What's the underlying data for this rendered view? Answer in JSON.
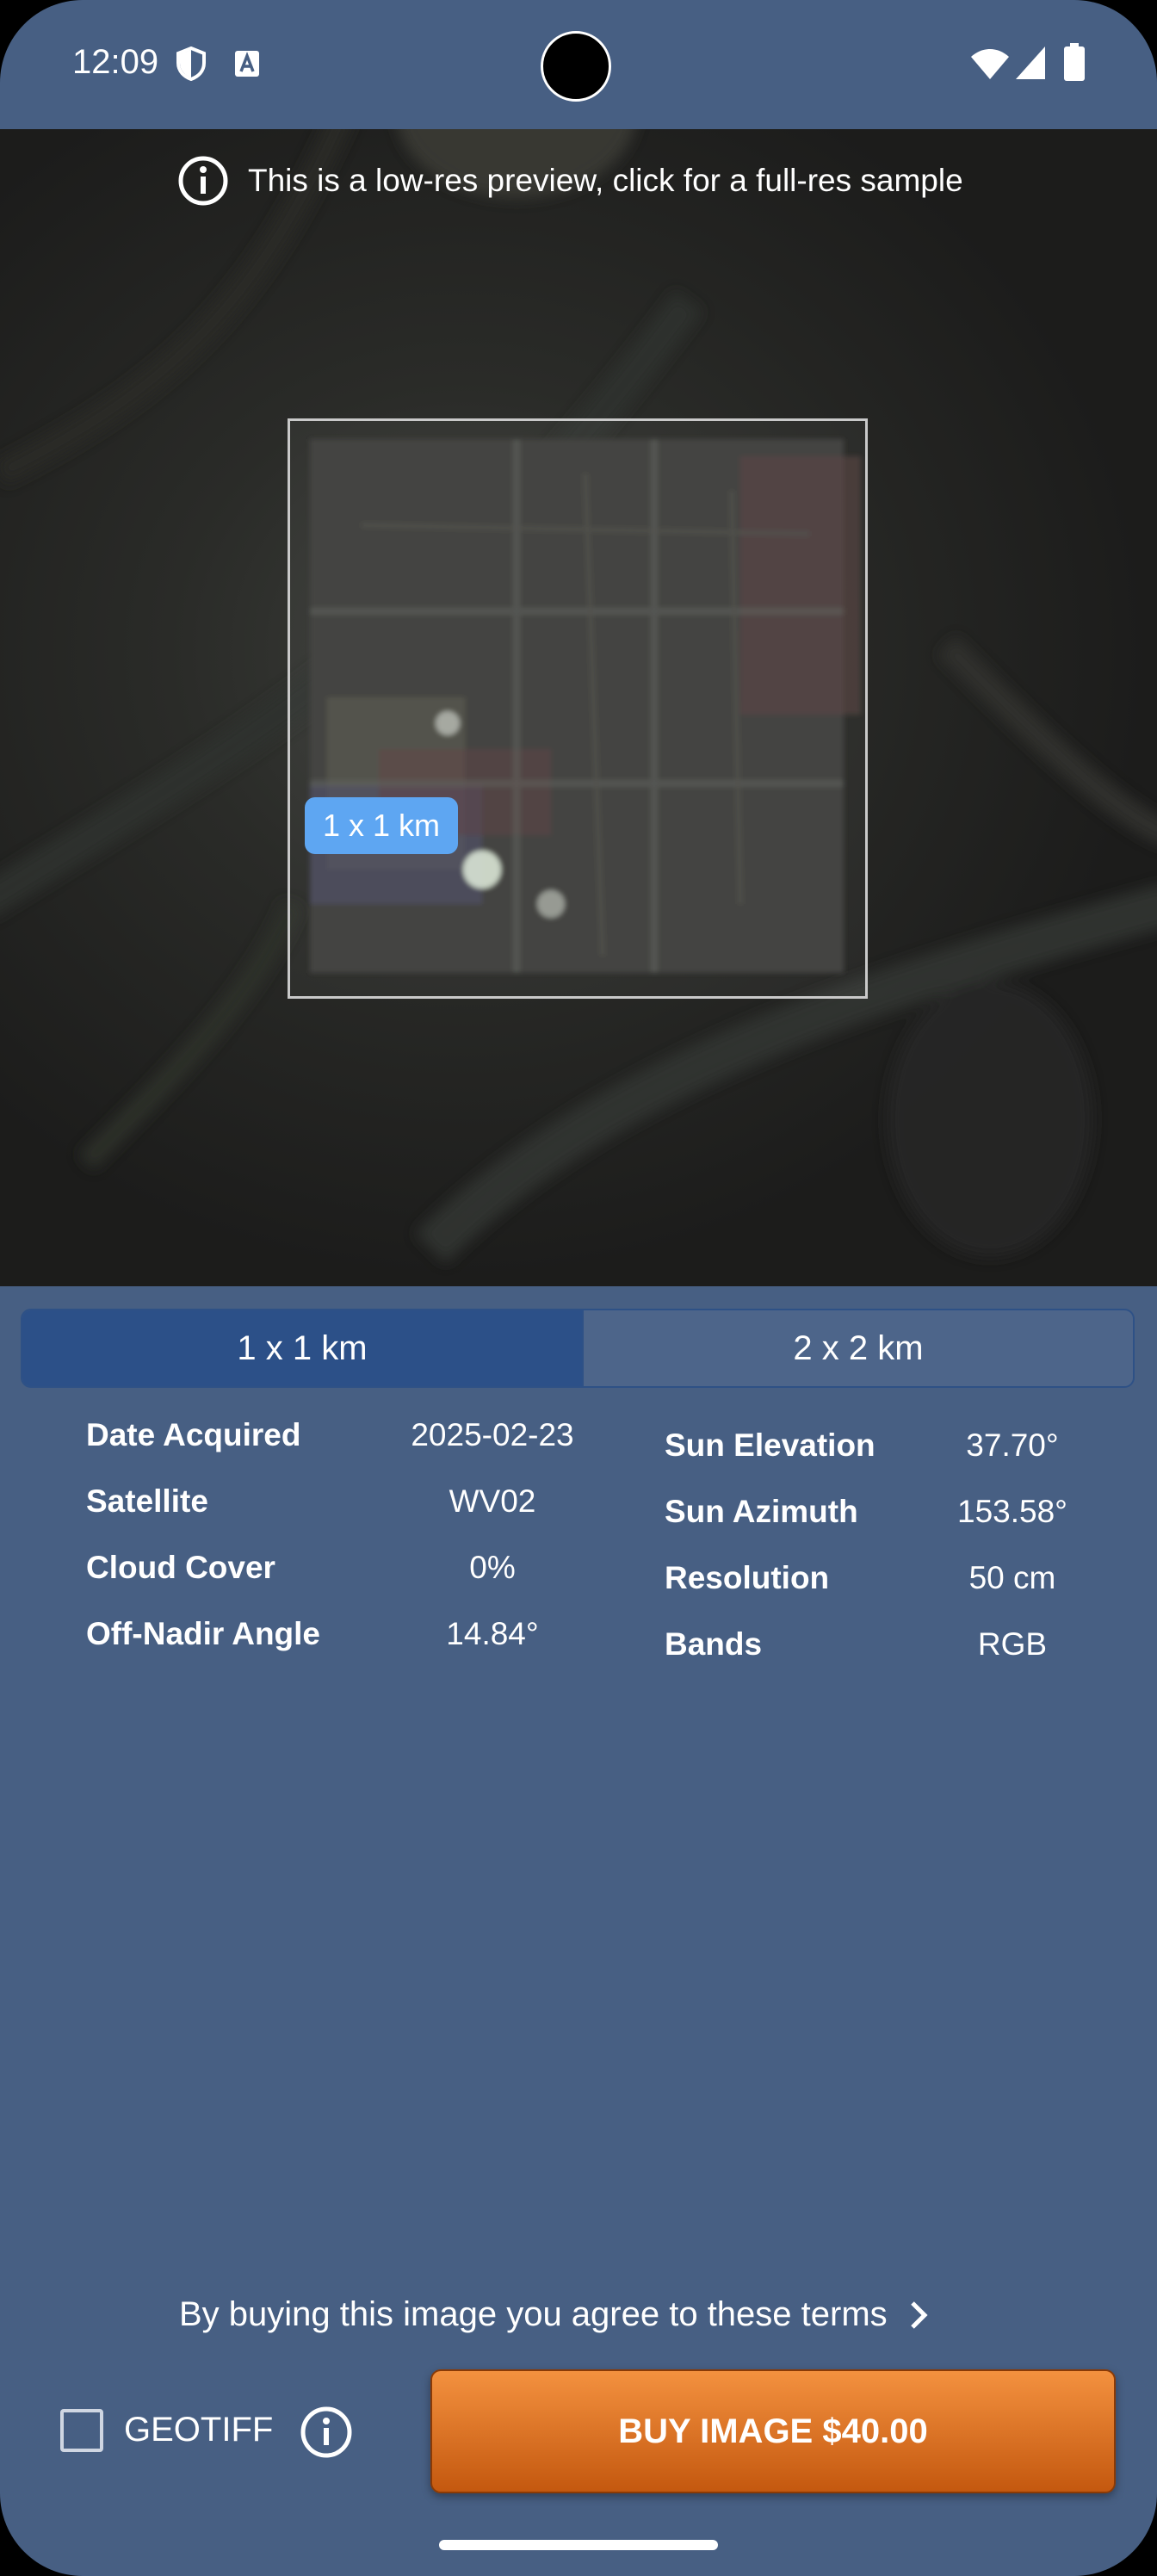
{
  "status_bar": {
    "time": "12:09",
    "icons": [
      "shield-icon",
      "a-notification-icon",
      "wifi-icon",
      "signal-icon",
      "battery-icon"
    ]
  },
  "preview": {
    "info_text": "This is a low-res preview, click for a full-res sample",
    "selection_label": "1 x 1 km"
  },
  "tabs": [
    {
      "label": "1 x 1 km",
      "active": true
    },
    {
      "label": "2 x 2 km",
      "active": false
    }
  ],
  "specs_left": [
    {
      "label": "Date Acquired",
      "value": "2025-02-23"
    },
    {
      "label": "Satellite",
      "value": "WV02"
    },
    {
      "label": "Cloud Cover",
      "value": "0%"
    },
    {
      "label": "Off-Nadir Angle",
      "value": "14.84°"
    }
  ],
  "specs_right": [
    {
      "label": "Sun Elevation",
      "value": "37.70°"
    },
    {
      "label": "Sun Azimuth",
      "value": "153.58°"
    },
    {
      "label": "Resolution",
      "value": "50 cm"
    },
    {
      "label": "Bands",
      "value": "RGB"
    }
  ],
  "footer": {
    "terms_text": "By buying this image you agree to these terms",
    "geotiff_label": "GEOTIFF",
    "geotiff_checked": false,
    "buy_label": "BUY IMAGE $40.00"
  },
  "colors": {
    "background": "#475f83",
    "tab_active": "#2c5088",
    "chip": "#5ea6f2",
    "buy_button": "#e07a2a"
  }
}
